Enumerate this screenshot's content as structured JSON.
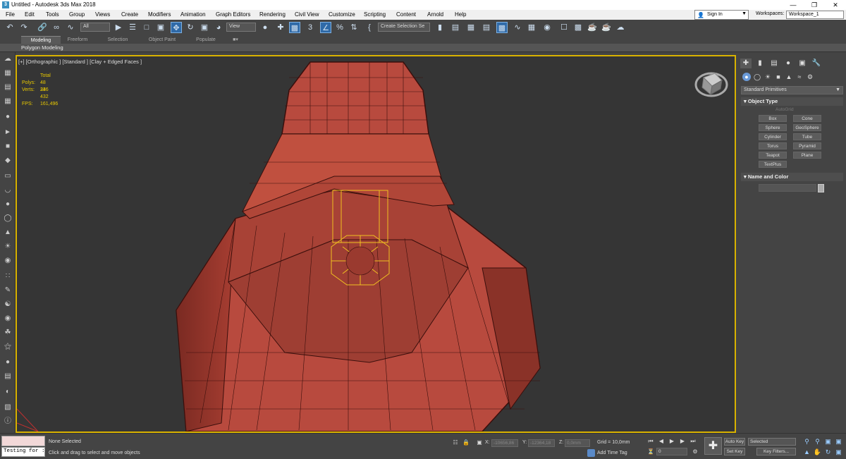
{
  "window": {
    "title": "Untitled - Autodesk 3ds Max 2018",
    "app_icon": "3"
  },
  "menu": [
    "File",
    "Edit",
    "Tools",
    "Group",
    "Views",
    "Create",
    "Modifiers",
    "Animation",
    "Graph Editors",
    "Rendering",
    "Civil View",
    "Customize",
    "Scripting",
    "Content",
    "Arnold",
    "Help"
  ],
  "account": {
    "sign_in": "Sign In",
    "workspaces_label": "Workspaces:",
    "workspace": "Workspace_1"
  },
  "toolbar": {
    "filter": "All",
    "ref_coord": "View",
    "angle_snap": "3",
    "percent_snap": "%",
    "named_selection": "Create Selection Se"
  },
  "ribbon": {
    "tabs": [
      "Modeling",
      "Freeform",
      "Selection",
      "Object Paint",
      "Populate"
    ],
    "active_tab": "Modeling",
    "panel_label": "Polygon Modeling"
  },
  "viewport": {
    "label": "[+] [Orthographic ] [Standard ] [Clay + Edged Faces ]",
    "stats": {
      "total": "Total",
      "polys_label": "Polys:",
      "polys": "48 336",
      "verts_label": "Verts:",
      "verts": "24 432",
      "fps_label": "FPS:",
      "fps": "161,496"
    }
  },
  "command_panel": {
    "category": "Standard Primitives",
    "object_type_title": "Object Type",
    "autogrid": "AutoGrid",
    "buttons": [
      "Box",
      "Cone",
      "Sphere",
      "GeoSphere",
      "Cylinder",
      "Tube",
      "Torus",
      "Pyramid",
      "Teapot",
      "Plane",
      "TextPlus"
    ],
    "name_color_title": "Name and Color"
  },
  "status": {
    "maxscript_input": "Testing for :",
    "selection": "None Selected",
    "prompt": "Click and drag to select and move objects",
    "x_label": "X:",
    "x_value": "-10656,86",
    "y_label": "Y:",
    "y_value": "-12364,18",
    "z_label": "Z:",
    "z_value": "0,0mm",
    "grid": "Grid = 10,0mm",
    "time_tag": "Add Time Tag",
    "frame": "0",
    "auto_key": "Auto Key",
    "set_key": "Set Key",
    "key_mode": "Selected",
    "key_filters": "Key Filters..."
  },
  "colors": {
    "model_fill": "#b84a3e",
    "selection_wire": "#f0c020",
    "viewport_bg": "#353535",
    "active_border": "#d8b200"
  }
}
